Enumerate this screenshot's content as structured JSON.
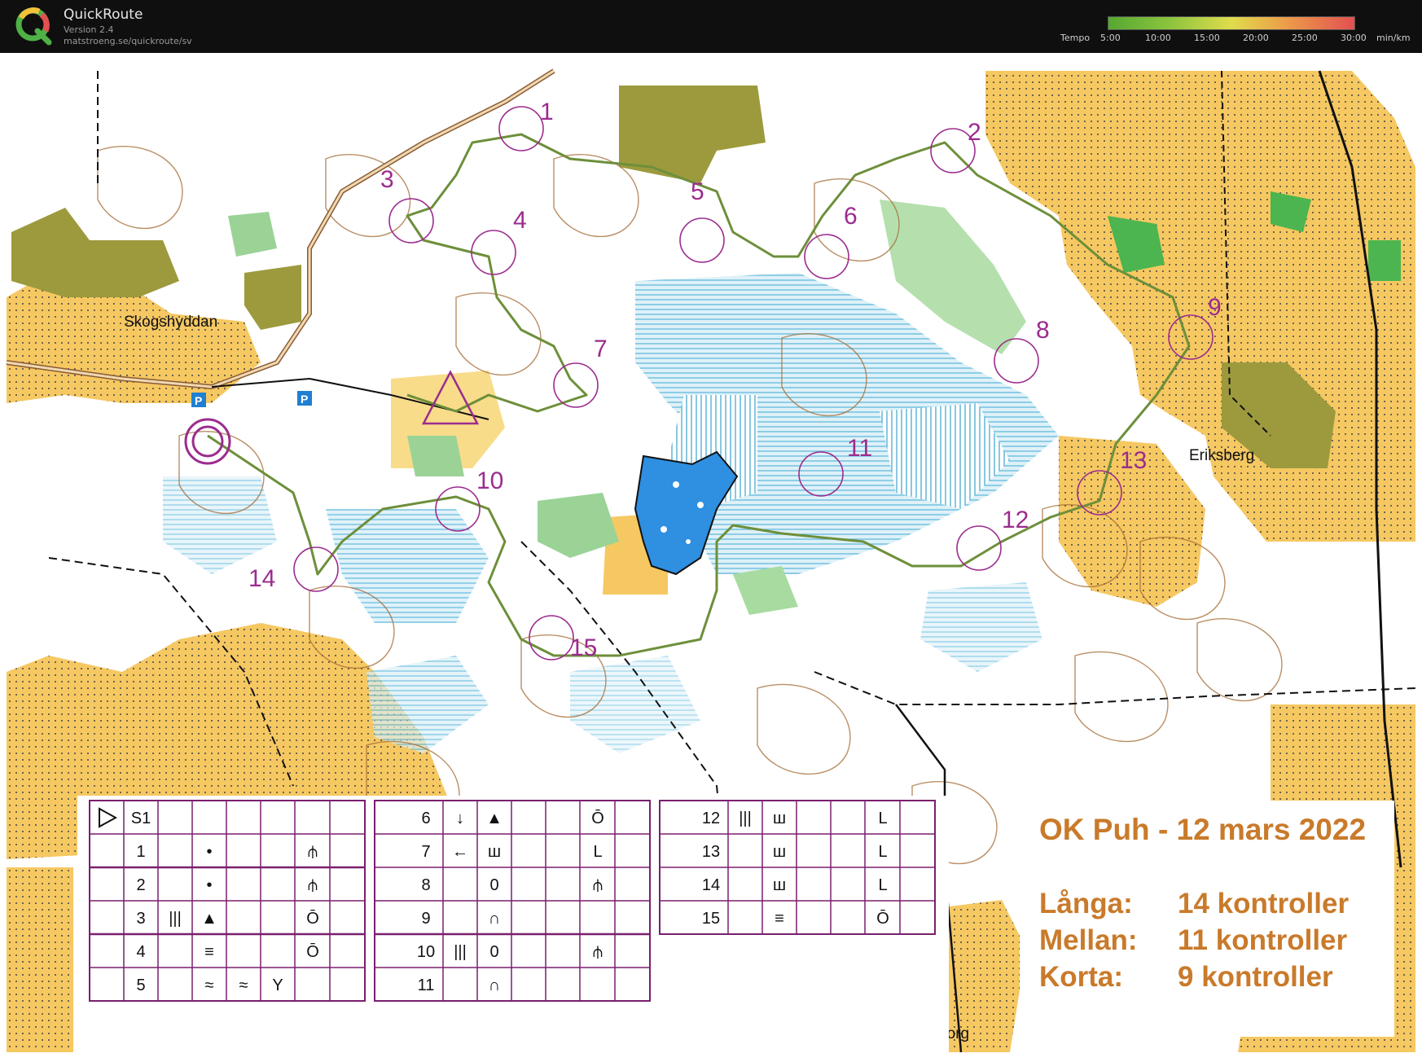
{
  "app": {
    "name": "QuickRoute",
    "version": "Version 2.4",
    "url": "matstroeng.se/quickroute/sv"
  },
  "tempo_legend": {
    "label": "Tempo",
    "ticks": [
      "5:00",
      "10:00",
      "15:00",
      "20:00",
      "25:00",
      "30:00"
    ],
    "unit": "min/km",
    "colors": [
      "#56a832",
      "#8cc43d",
      "#e0dc4c",
      "#ec9d4a",
      "#e25050"
    ]
  },
  "map": {
    "place_names": [
      "Skogshyddan",
      "Eriksberg",
      "Persborg"
    ],
    "parking_symbol": "P",
    "controls": [
      "1",
      "2",
      "3",
      "4",
      "5",
      "6",
      "7",
      "8",
      "9",
      "10",
      "11",
      "12",
      "13",
      "14",
      "15"
    ],
    "colors": {
      "forest": "#ffffff",
      "open_land": "#f2b43c",
      "rough_open": "#f8dc8a",
      "green": "#8dcf8a",
      "marsh": "#35a8d8",
      "water": "#2f8fe0",
      "contour": "#a36a33",
      "course": "#9b2c8e",
      "route": "#6d8f3a"
    }
  },
  "control_descriptions": {
    "table1": [
      {
        "code": "S1",
        "c1": "",
        "c2": "",
        "c3": "",
        "c4": "",
        "c5": ""
      },
      {
        "code": "1",
        "c1": "",
        "c2": "•",
        "c3": "",
        "c4": "",
        "c5": "⫛"
      },
      {
        "code": "2",
        "c1": "",
        "c2": "•",
        "c3": "",
        "c4": "",
        "c5": "⫛"
      },
      {
        "code": "3",
        "c1": "|||",
        "c2": "▲",
        "c3": "",
        "c4": "",
        "c5": "Ō"
      },
      {
        "code": "4",
        "c1": "",
        "c2": "≡",
        "c3": "",
        "c4": "",
        "c5": "Ō"
      },
      {
        "code": "5",
        "c1": "",
        "c2": "≈",
        "c3": "≈",
        "c4": "Y",
        "c5": ""
      }
    ],
    "table2": [
      {
        "code": "6",
        "c1": "↓",
        "c2": "▲",
        "c3": "",
        "c4": "",
        "c5": "Ō"
      },
      {
        "code": "7",
        "c1": "←",
        "c2": "ш",
        "c3": "",
        "c4": "",
        "c5": "L"
      },
      {
        "code": "8",
        "c1": "",
        "c2": "0",
        "c3": "",
        "c4": "",
        "c5": "⫛"
      },
      {
        "code": "9",
        "c1": "",
        "c2": "∩",
        "c3": "",
        "c4": "",
        "c5": ""
      },
      {
        "code": "10",
        "c1": "|||",
        "c2": "0",
        "c3": "",
        "c4": "",
        "c5": "⫛"
      },
      {
        "code": "11",
        "c1": "",
        "c2": "∩",
        "c3": "",
        "c4": "",
        "c5": ""
      }
    ],
    "table3": [
      {
        "code": "12",
        "c1": "|||",
        "c2": "ш",
        "c3": "",
        "c4": "",
        "c5": "L"
      },
      {
        "code": "13",
        "c1": "",
        "c2": "ш",
        "c3": "",
        "c4": "",
        "c5": "L"
      },
      {
        "code": "14",
        "c1": "",
        "c2": "ш",
        "c3": "",
        "c4": "",
        "c5": "L"
      },
      {
        "code": "15",
        "c1": "",
        "c2": "≡",
        "c3": "",
        "c4": "",
        "c5": "Ō"
      }
    ]
  },
  "event": {
    "title": "OK Puh - 12 mars 2022",
    "courses": [
      {
        "name": "Långa:",
        "count": "14 kontroller"
      },
      {
        "name": "Mellan:",
        "count": "11 kontroller"
      },
      {
        "name": "Korta:",
        "count": "9 kontroller"
      }
    ]
  }
}
